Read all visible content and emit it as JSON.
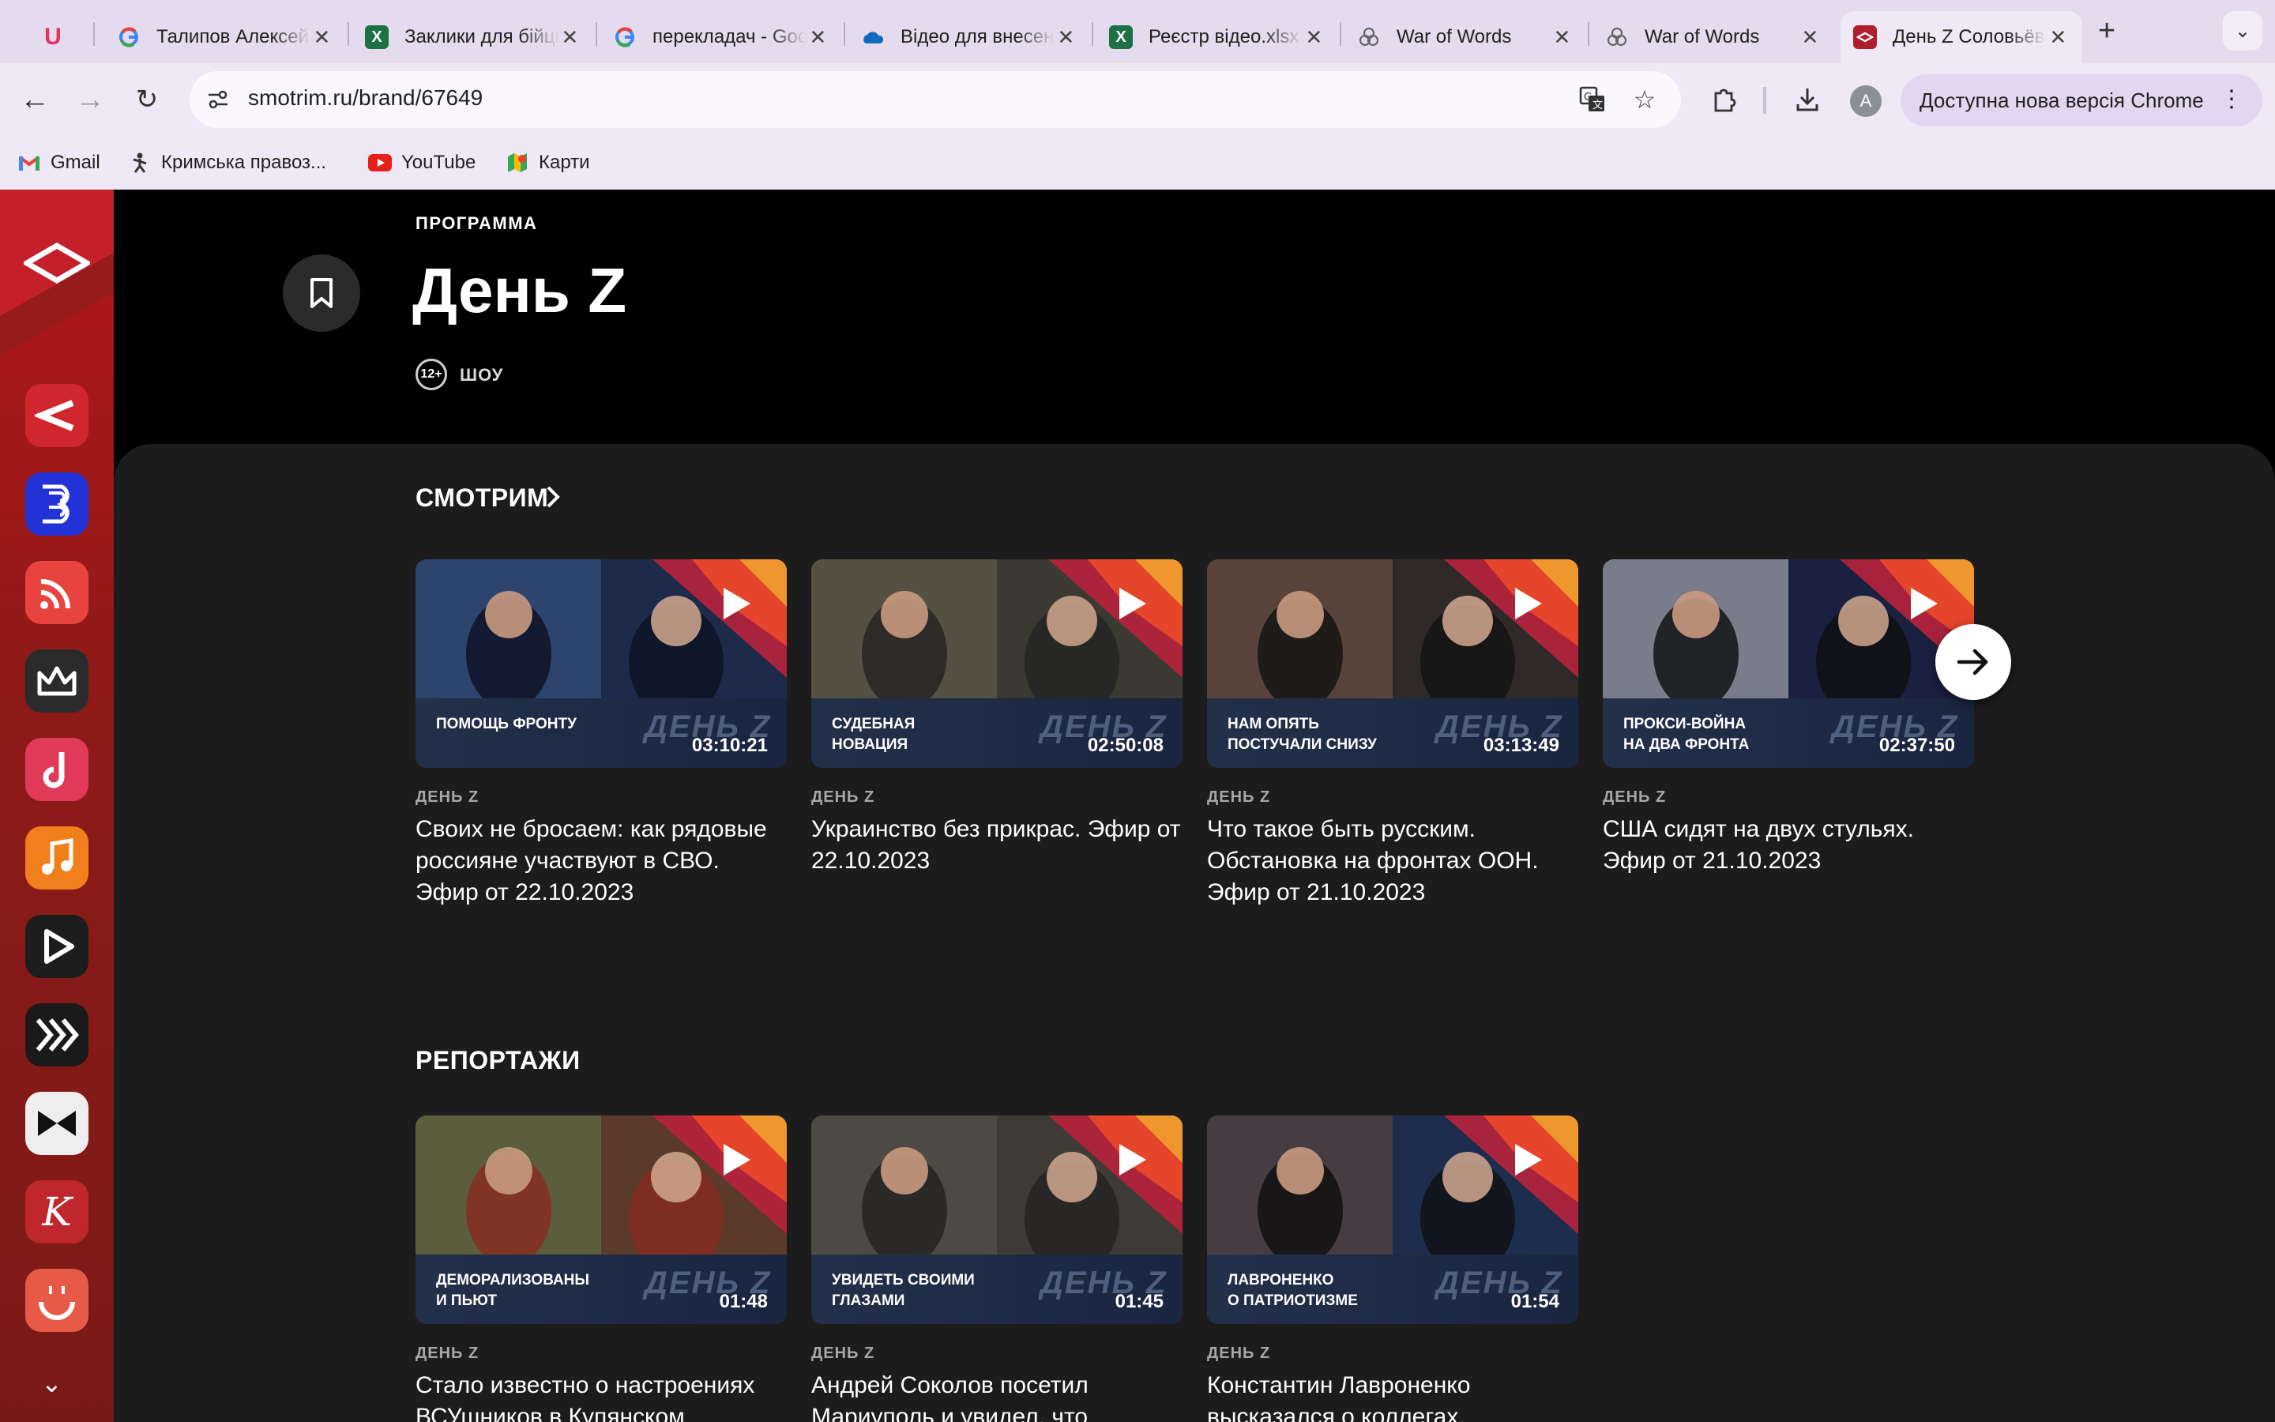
{
  "browser": {
    "tabs": [
      {
        "title": "Талипов Алексей",
        "icon": "google-icon",
        "color": "#4285f4"
      },
      {
        "title": "Заклики для бійців",
        "icon": "excel-icon",
        "color": "#1d7044"
      },
      {
        "title": "перекладач - Google",
        "icon": "google-icon",
        "color": "#4285f4"
      },
      {
        "title": "Відео для внесення",
        "icon": "onedrive-icon",
        "color": "#0f6cbd"
      },
      {
        "title": "Реєстр відео.xlsx",
        "icon": "excel-icon",
        "color": "#1d7044"
      },
      {
        "title": "War of Words",
        "icon": "network-icon",
        "color": "#777777"
      },
      {
        "title": "War of Words",
        "icon": "network-icon",
        "color": "#777777"
      },
      {
        "title": "День Z Соловьёв",
        "icon": "smotrim-icon",
        "color": "#b01e2d"
      }
    ],
    "url": "smotrim.ru/brand/67649",
    "avatar_letter": "A",
    "update_label": "Доступна нова версія Chrome",
    "bookmarks": [
      {
        "label": "Gmail",
        "icon": "gmail-icon"
      },
      {
        "label": "Кримська правоз...",
        "icon": "figure-icon"
      },
      {
        "label": "YouTube",
        "icon": "youtube-icon"
      },
      {
        "label": "Карти",
        "icon": "maps-icon"
      }
    ]
  },
  "page": {
    "eyebrow": "ПРОГРАММА",
    "title": "День Z",
    "rating": "12+",
    "genre": "ШОУ",
    "sections": [
      {
        "title": "СМОТРИМ",
        "cards": [
          {
            "caption": "ПОМОЩЬ ФРОНТУ",
            "duration": "03:10:21",
            "kicker": "ДЕНЬ Z",
            "title": "Своих не бросаем: как рядовые россияне участвуют в СВО. Эфир от 22.10.2023"
          },
          {
            "caption": "СУДЕБНАЯ\nНОВАЦИЯ",
            "duration": "02:50:08",
            "kicker": "ДЕНЬ Z",
            "title": "Украинство без прикрас. Эфир от 22.10.2023"
          },
          {
            "caption": "НАМ ОПЯТЬ\nПОСТУЧАЛИ СНИЗУ",
            "duration": "03:13:49",
            "kicker": "ДЕНЬ Z",
            "title": "Что такое быть русским. Обстановка на фронтах ООН. Эфир от 21.10.2023"
          },
          {
            "caption": "ПРОКСИ-ВОЙНА\nНА ДВА ФРОНТА",
            "duration": "02:37:50",
            "kicker": "ДЕНЬ Z",
            "title": "США сидят на двух стульях. Эфир от 21.10.2023"
          }
        ]
      },
      {
        "title": "РЕПОРТАЖИ",
        "cards": [
          {
            "caption": "ДЕМОРАЛИЗОВАНЫ\nИ ПЬЮТ",
            "duration": "01:48",
            "kicker": "ДЕНЬ Z",
            "title": "Стало известно о настроениях ВСУшников в Купянском"
          },
          {
            "caption": "УВИДЕТЬ СВОИМИ\nГЛАЗАМИ",
            "duration": "01:45",
            "kicker": "ДЕНЬ Z",
            "title": "Андрей Соколов посетил Мариуполь и увидел, что"
          },
          {
            "caption": "ЛАВРОНЕНКО\nО ПАТРИОТИЗМЕ",
            "duration": "01:54",
            "kicker": "ДЕНЬ Z",
            "title": "Константин Лавроненко высказался о коллегах,"
          }
        ]
      }
    ],
    "thumb_brandmark": "ДЕНЬ Z",
    "accent": "#e63127"
  },
  "rail": {
    "apps": [
      {
        "name": "smotrim-app-icon",
        "color": "#d0262d"
      },
      {
        "name": "b-app-icon",
        "color": "#2232d6"
      },
      {
        "name": "podcast-app-icon",
        "color": "#e8433f"
      },
      {
        "name": "crown-app-icon",
        "color": "#2b2b2b"
      },
      {
        "name": "note-app-icon",
        "color": "#e03a58"
      },
      {
        "name": "music-app-icon",
        "color": "#f07f1c"
      },
      {
        "name": "play-app-icon",
        "color": "#1d1d1d"
      },
      {
        "name": "chevrons-app-icon",
        "color": "#1a1a1a"
      },
      {
        "name": "bowtie-app-icon",
        "color": "#eeeeee"
      },
      {
        "name": "k-app-icon",
        "color": "#c0272d"
      },
      {
        "name": "face-app-icon",
        "color": "#e85a48"
      }
    ]
  }
}
